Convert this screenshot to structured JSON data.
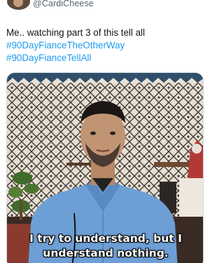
{
  "tweet": {
    "handle": "@CardiCheese",
    "text_line": "Me.. watching part 3 of this tell all",
    "hashtags": [
      "#90DayFianceTheOtherWay",
      "#90DayFianceTellAll"
    ]
  },
  "media": {
    "subtitle_lines": [
      "I try to understand, but I",
      "understand nothing."
    ]
  }
}
